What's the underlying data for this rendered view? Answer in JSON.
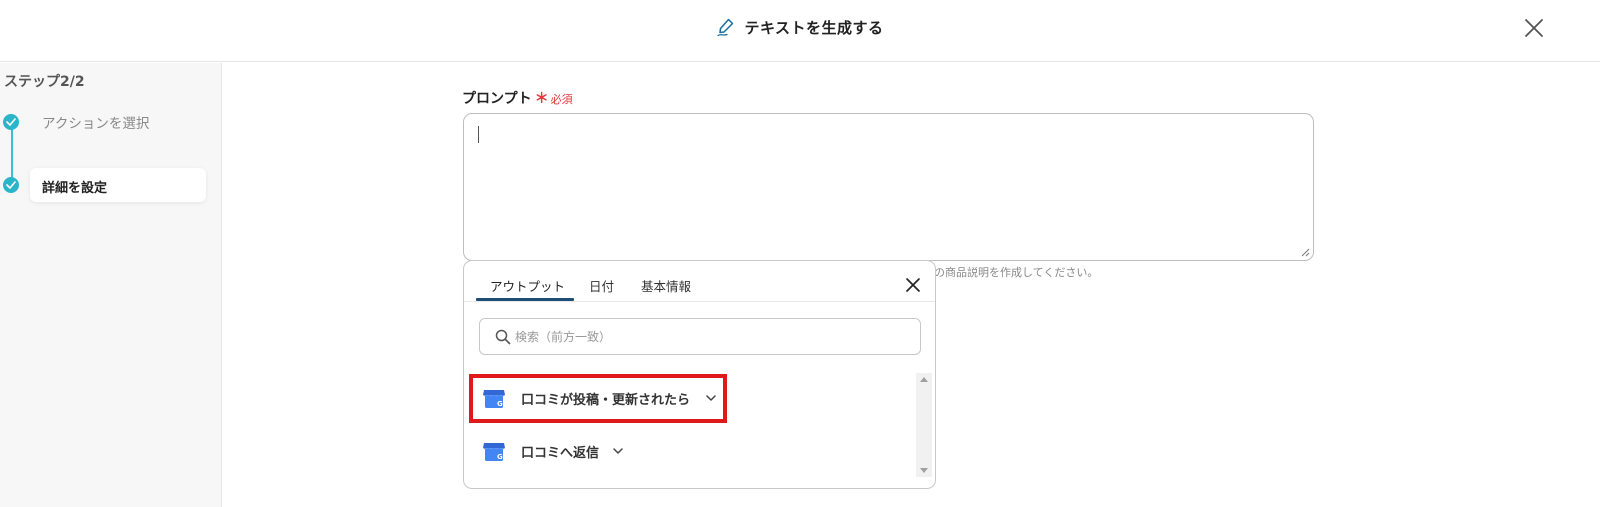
{
  "header": {
    "title": "テキストを生成する",
    "title_icon": "pen-icon",
    "close_icon": "close-icon"
  },
  "sidebar": {
    "step_heading": "ステップ2/2",
    "steps": [
      {
        "label": "アクションを選択",
        "status": "completed"
      },
      {
        "label": "詳細を設定",
        "status": "current"
      }
    ]
  },
  "main": {
    "prompt_label": "プロンプト",
    "required_mark": "＊",
    "required_text": "必須",
    "prompt_value": "",
    "helper_text": "の商品説明を作成してください。"
  },
  "dropdown": {
    "tabs": [
      {
        "label": "アウトプット",
        "active": true
      },
      {
        "label": "日付",
        "active": false
      },
      {
        "label": "基本情報",
        "active": false
      }
    ],
    "search_placeholder": "検索（前方一致）",
    "items": [
      {
        "label": "口コミが投稿・更新されたら",
        "icon": "google-business-icon",
        "highlighted": true
      },
      {
        "label": "口コミへ返信",
        "icon": "google-business-icon",
        "highlighted": false
      }
    ]
  },
  "colors": {
    "accent_teal": "#2bb5c8",
    "tab_underline": "#1d4e74",
    "required_red": "#e0383e",
    "highlight_red": "#e01a1a",
    "google_blue": "#4285f4"
  }
}
